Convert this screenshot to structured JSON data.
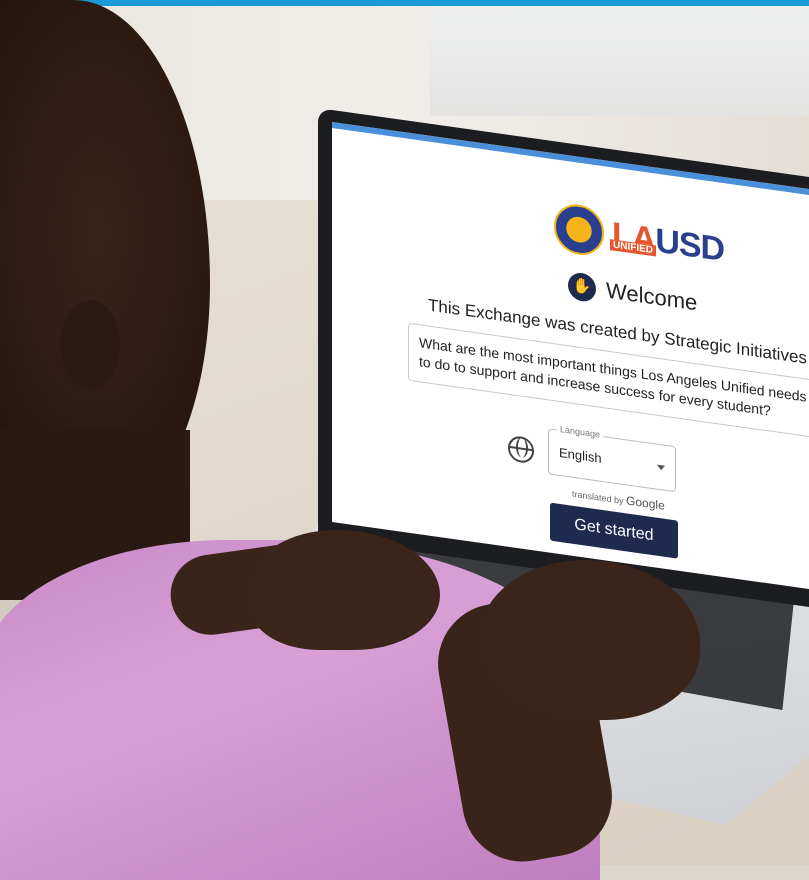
{
  "screen": {
    "logo": {
      "seal_icon": "lausd-seal-icon",
      "wordmark_la": "LA",
      "wordmark_usd": "USD",
      "wordmark_sub": "UNIFIED"
    },
    "welcome": {
      "icon": "waving-hand-icon",
      "title": "Welcome"
    },
    "created_by": "This Exchange was created by Strategic Initiatives Office",
    "question": "What are the most important things Los Angeles Unified needs to do to support and increase success for every student?",
    "language": {
      "icon": "globe-icon",
      "label": "Language",
      "selected": "English"
    },
    "translated_by_prefix": "translated by",
    "translated_by_brand": "Google",
    "cta_label": "Get started"
  },
  "colors": {
    "top_bar": "#1a9ad6",
    "la_orange": "#e4572e",
    "usd_blue": "#2b3f8f",
    "button_navy": "#1f2a4f",
    "shirt_pink": "#c889c7"
  }
}
